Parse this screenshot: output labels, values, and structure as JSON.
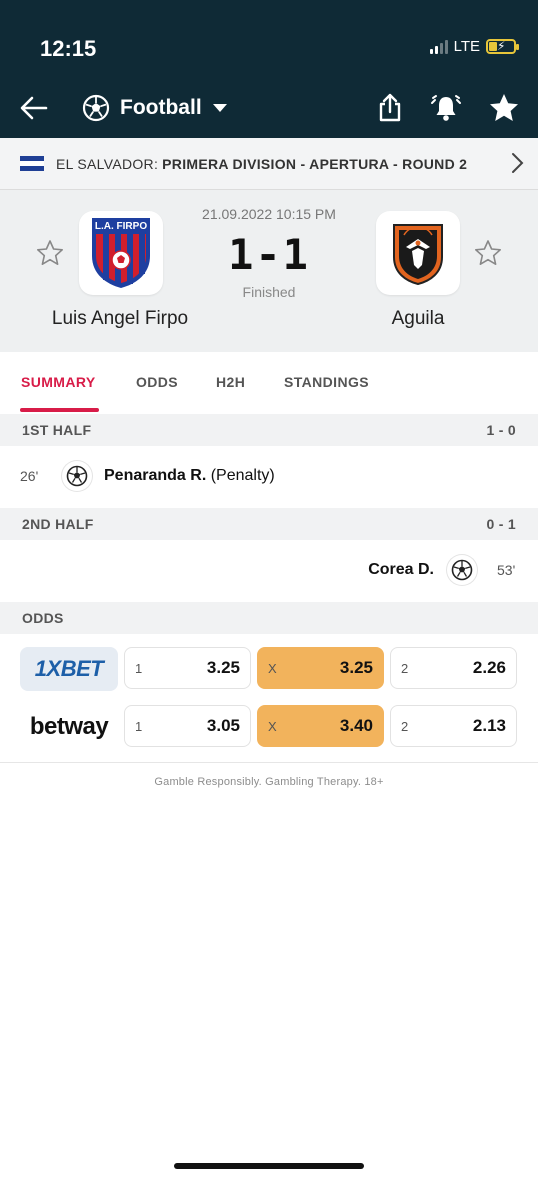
{
  "status_bar": {
    "time": "12:15",
    "network": "LTE"
  },
  "header": {
    "sport": "Football",
    "icons": [
      "back-arrow-icon",
      "football-icon",
      "chevron-down-icon",
      "share-icon",
      "bell-icon",
      "star-icon"
    ]
  },
  "league": {
    "country": "EL SALVADOR:",
    "competition": "PRIMERA DIVISION - APERTURA - ROUND 2",
    "flag_colors": [
      "#1f3f95",
      "#ffffff",
      "#1f3f95"
    ]
  },
  "match": {
    "datetime": "21.09.2022 10:15 PM",
    "score": "1-1",
    "status": "Finished",
    "home": {
      "name": "Luis Angel Firpo",
      "crest_text": "L.A. FIRPO"
    },
    "away": {
      "name": "Aguila"
    }
  },
  "tabs": [
    {
      "label": "SUMMARY",
      "active": true
    },
    {
      "label": "ODDS",
      "active": false
    },
    {
      "label": "H2H",
      "active": false
    },
    {
      "label": "STANDINGS",
      "active": false
    }
  ],
  "summary": {
    "first_half": {
      "label": "1ST HALF",
      "score": "1 - 0"
    },
    "event1": {
      "minute": "26'",
      "player": "Penaranda R.",
      "detail": "(Penalty)"
    },
    "second_half": {
      "label": "2ND HALF",
      "score": "0 - 1"
    },
    "event2": {
      "minute": "53'",
      "player": "Corea D."
    }
  },
  "odds": {
    "label": "ODDS",
    "rows": [
      {
        "bookmaker": "1XBET",
        "cells": [
          {
            "label": "1",
            "value": "3.25"
          },
          {
            "label": "X",
            "value": "3.25"
          },
          {
            "label": "2",
            "value": "2.26"
          }
        ]
      },
      {
        "bookmaker": "betway",
        "cells": [
          {
            "label": "1",
            "value": "3.05"
          },
          {
            "label": "X",
            "value": "3.40"
          },
          {
            "label": "2",
            "value": "2.13"
          }
        ]
      }
    ],
    "highlight_color": "#f2b35c"
  },
  "footer_note": "Gamble Responsibly. Gambling Therapy. 18+",
  "colors": {
    "header_bg": "#0f2a36",
    "accent": "#d81c48"
  }
}
